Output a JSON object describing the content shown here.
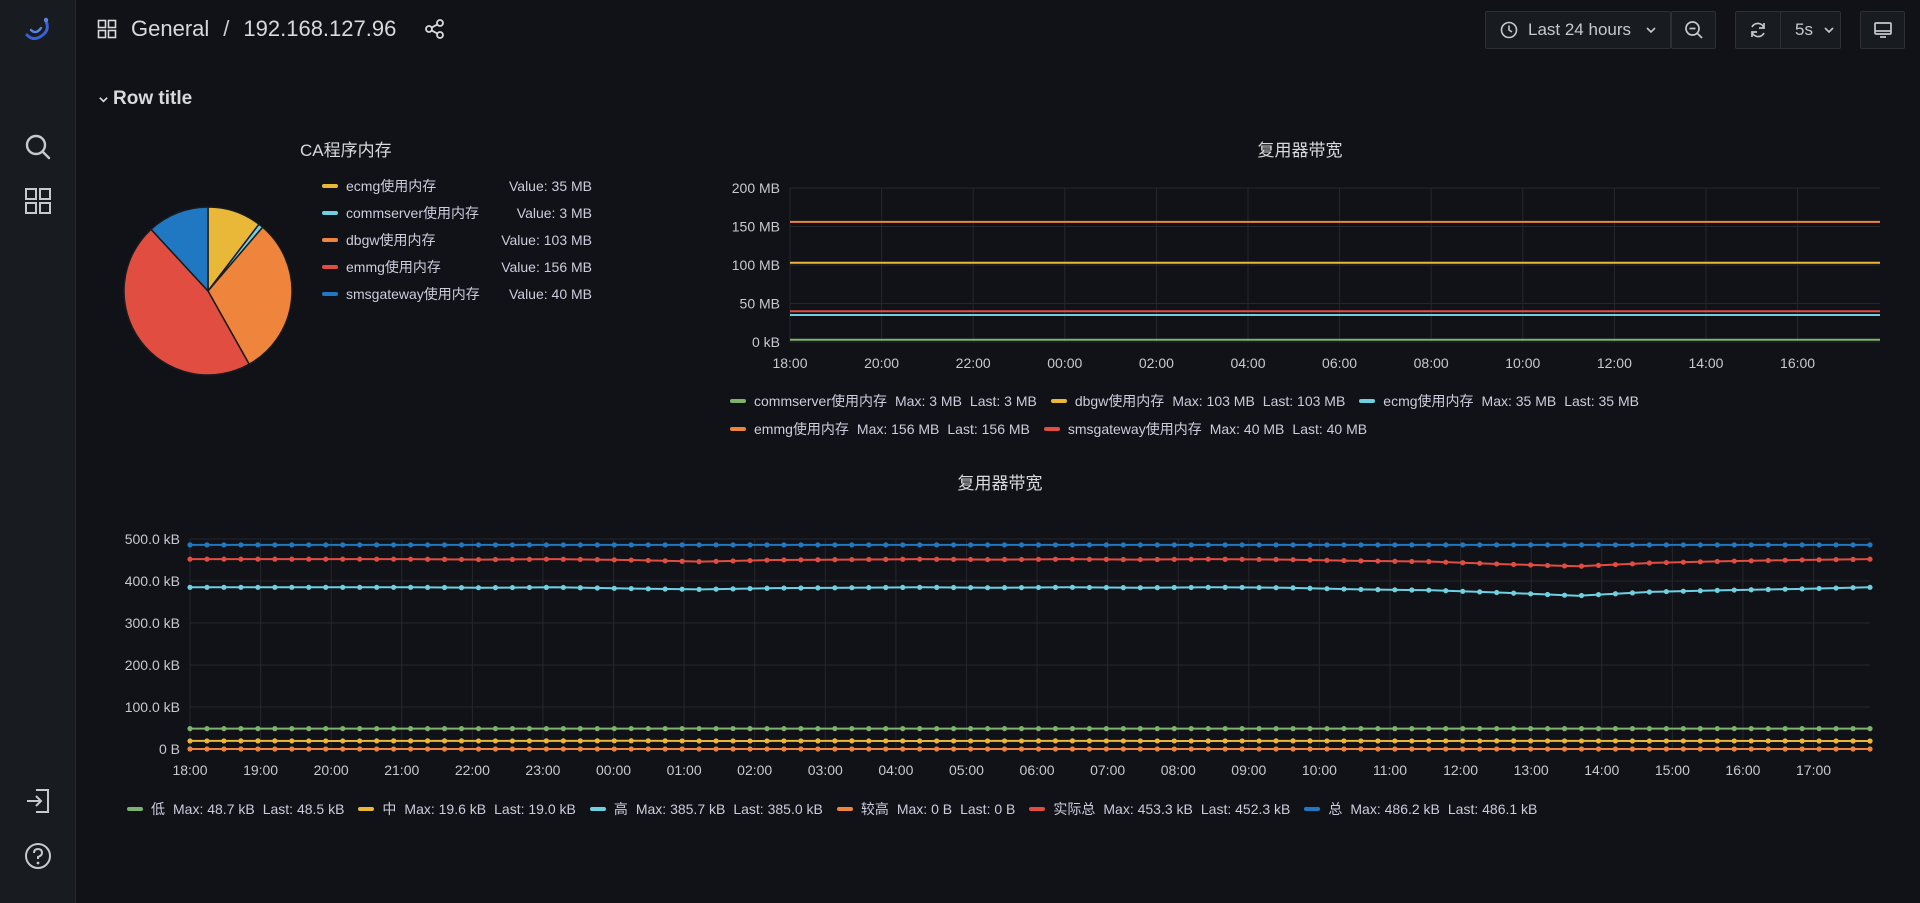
{
  "breadcrumb": {
    "folder": "General",
    "separator": "/",
    "dashboard": "192.168.127.96"
  },
  "toolbar": {
    "time_range": "Last 24 hours",
    "refresh_interval": "5s"
  },
  "row": {
    "title": "Row title"
  },
  "colors": {
    "green": "#73bf69",
    "yellow": "#fade2a",
    "lightblue": "#8ab8ff",
    "cyan": "#5dcfe8",
    "orange": "#ff9830",
    "red": "#f2495c",
    "blue": "#3274d9"
  },
  "pie_panel": {
    "title": "CA程序内存",
    "legend": [
      {
        "name": "ecmg使用内存",
        "value": "Value: 35 MB",
        "color": "#eab839"
      },
      {
        "name": "commserver使用内存",
        "value": "Value: 3 MB",
        "color": "#6ed0e0"
      },
      {
        "name": "dbgw使用内存",
        "value": "Value: 103 MB",
        "color": "#ef843c"
      },
      {
        "name": "emmg使用内存",
        "value": "Value: 156 MB",
        "color": "#e24d42"
      },
      {
        "name": "smsgateway使用内存",
        "value": "Value: 40 MB",
        "color": "#1f78c1"
      }
    ]
  },
  "mux_panel_1": {
    "title": "复用器带宽",
    "legend": [
      {
        "name": "commserver使用内存",
        "max": "Max: 3 MB",
        "last": "Last: 3 MB",
        "color": "#7eb26d"
      },
      {
        "name": "dbgw使用内存",
        "max": "Max: 103 MB",
        "last": "Last: 103 MB",
        "color": "#eab839"
      },
      {
        "name": "ecmg使用内存",
        "max": "Max: 35 MB",
        "last": "Last: 35 MB",
        "color": "#6ed0e0"
      },
      {
        "name": "emmg使用内存",
        "max": "Max: 156 MB",
        "last": "Last: 156 MB",
        "color": "#ef843c"
      },
      {
        "name": "smsgateway使用内存",
        "max": "Max: 40 MB",
        "last": "Last: 40 MB",
        "color": "#e24d42"
      }
    ]
  },
  "mux_panel_2": {
    "title": "复用器带宽",
    "legend": [
      {
        "name": "低",
        "max": "Max: 48.7 kB",
        "last": "Last: 48.5 kB",
        "color": "#7eb26d"
      },
      {
        "name": "中",
        "max": "Max: 19.6 kB",
        "last": "Last: 19.0 kB",
        "color": "#eab839"
      },
      {
        "name": "高",
        "max": "Max: 385.7 kB",
        "last": "Last: 385.0 kB",
        "color": "#6ed0e0"
      },
      {
        "name": "较高",
        "max": "Max: 0 B",
        "last": "Last: 0 B",
        "color": "#ef843c"
      },
      {
        "name": "实际总",
        "max": "Max: 453.3 kB",
        "last": "Last: 452.3 kB",
        "color": "#e24d42"
      },
      {
        "name": "总",
        "max": "Max: 486.2 kB",
        "last": "Last: 486.1 kB",
        "color": "#1f78c1"
      }
    ]
  },
  "chart_data": [
    {
      "type": "pie",
      "title": "CA程序内存",
      "categories": [
        "ecmg使用内存",
        "commserver使用内存",
        "dbgw使用内存",
        "emmg使用内存",
        "smsgateway使用内存"
      ],
      "values": [
        35,
        3,
        103,
        156,
        40
      ],
      "unit": "MB",
      "legend": "right"
    },
    {
      "type": "line",
      "title": "复用器带宽",
      "x": [
        "18:00",
        "20:00",
        "22:00",
        "00:00",
        "02:00",
        "04:00",
        "06:00",
        "08:00",
        "10:00",
        "12:00",
        "14:00",
        "16:00"
      ],
      "y_ticks": [
        "0 kB",
        "50 MB",
        "100 MB",
        "150 MB",
        "200 MB"
      ],
      "ylim": [
        0,
        200
      ],
      "unit": "MB",
      "grid": true,
      "legend": "bottom",
      "series": [
        {
          "name": "commserver使用内存",
          "values": [
            3,
            3,
            3,
            3,
            3,
            3,
            3,
            3,
            3,
            3,
            3,
            3
          ],
          "color": "#7eb26d"
        },
        {
          "name": "dbgw使用内存",
          "values": [
            103,
            103,
            103,
            103,
            103,
            103,
            103,
            103,
            103,
            103,
            103,
            103
          ],
          "color": "#eab839"
        },
        {
          "name": "ecmg使用内存",
          "values": [
            35,
            35,
            35,
            35,
            35,
            35,
            35,
            35,
            35,
            35,
            35,
            35
          ],
          "color": "#6ed0e0"
        },
        {
          "name": "emmg使用内存",
          "values": [
            156,
            156,
            156,
            156,
            156,
            156,
            156,
            156,
            156,
            156,
            156,
            156
          ],
          "color": "#ef843c"
        },
        {
          "name": "smsgateway使用内存",
          "values": [
            40,
            40,
            40,
            40,
            40,
            40,
            40,
            40,
            40,
            40,
            40,
            40
          ],
          "color": "#e24d42"
        }
      ]
    },
    {
      "type": "line",
      "title": "复用器带宽",
      "x": [
        "18:00",
        "19:00",
        "20:00",
        "21:00",
        "22:00",
        "23:00",
        "00:00",
        "01:00",
        "02:00",
        "03:00",
        "04:00",
        "05:00",
        "06:00",
        "07:00",
        "08:00",
        "09:00",
        "10:00",
        "11:00",
        "12:00",
        "13:00",
        "14:00",
        "15:00",
        "16:00",
        "17:00"
      ],
      "y_ticks": [
        "0 B",
        "100.0 kB",
        "200.0 kB",
        "300.0 kB",
        "400.0 kB",
        "500.0 kB"
      ],
      "ylim": [
        0,
        500
      ],
      "unit": "kB",
      "grid": true,
      "points": true,
      "legend": "bottom",
      "series": [
        {
          "name": "低",
          "values": [
            48.5,
            48.5,
            48.6,
            48.5,
            48.6,
            48.5,
            48.6,
            48.7,
            48.5,
            48.6,
            48.5,
            48.6,
            48.5,
            48.5,
            48.6,
            48.5,
            48.6,
            48.5,
            48.6,
            48.5,
            48.5,
            48.6,
            48.5,
            48.5
          ],
          "color": "#7eb26d"
        },
        {
          "name": "中",
          "values": [
            19.2,
            19.3,
            19.1,
            19.4,
            19.2,
            19.3,
            19.6,
            19.1,
            19.2,
            19.3,
            19.1,
            19.2,
            19.3,
            19.2,
            19.1,
            19.3,
            19.2,
            19.1,
            19.3,
            19.2,
            19.1,
            19.2,
            19.1,
            19.0
          ],
          "color": "#eab839"
        },
        {
          "name": "高",
          "values": [
            385,
            385,
            385,
            385,
            384,
            385,
            382,
            380,
            383,
            384,
            385,
            384,
            385,
            384,
            385,
            384,
            380,
            378,
            372,
            365,
            374,
            378,
            381,
            385
          ],
          "color": "#6ed0e0"
        },
        {
          "name": "较高",
          "values": [
            0,
            0,
            0,
            0,
            0,
            0,
            0,
            0,
            0,
            0,
            0,
            0,
            0,
            0,
            0,
            0,
            0,
            0,
            0,
            0,
            0,
            0,
            0,
            0
          ],
          "color": "#ef843c"
        },
        {
          "name": "实际总",
          "values": [
            452,
            452,
            452,
            452,
            451,
            452,
            450,
            446,
            450,
            451,
            452,
            451,
            452,
            451,
            452,
            451,
            448,
            446,
            440,
            435,
            443,
            447,
            450,
            452
          ],
          "color": "#e24d42"
        },
        {
          "name": "总",
          "values": [
            486,
            486,
            486,
            486,
            486,
            486,
            486,
            486,
            486,
            486,
            486,
            486,
            486,
            486,
            486,
            486,
            486,
            486,
            486,
            486,
            486,
            486,
            486,
            486
          ],
          "color": "#1f78c1"
        }
      ]
    }
  ]
}
